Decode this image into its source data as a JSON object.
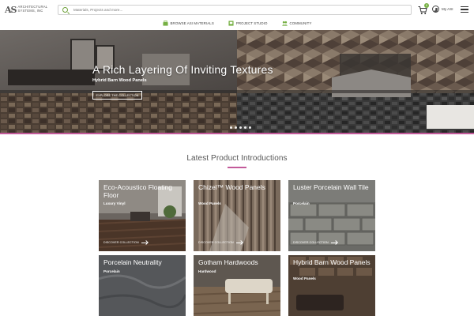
{
  "brand": {
    "mark": "AS",
    "name_line1": "ARCHITECTURAL",
    "name_line2": "SYSTEMS, INC"
  },
  "search": {
    "placeholder": "Materials, Projects and more..."
  },
  "cart": {
    "count": "0"
  },
  "account": {
    "label": "My ASI"
  },
  "nav": [
    {
      "label": "BROWSE ASI MATERIALS",
      "icon": "materials-icon"
    },
    {
      "label": "PROJECT STUDIO",
      "icon": "studio-icon"
    },
    {
      "label": "COMMUNITY",
      "icon": "community-icon"
    }
  ],
  "hero": {
    "title": "A Rich Layering Of Inviting Textures",
    "subtitle": "Hybrid Barn Wood Panels",
    "cta": "EXPLORE THE COLLECTION",
    "accent_color": "#c35a9a"
  },
  "section": {
    "title": "Latest Product Introductions"
  },
  "products": [
    {
      "title": "Eco-Acoustico Floating Floor",
      "category": "Luxury Vinyl",
      "cta": "DISCOVER COLLECTION"
    },
    {
      "title": "Chizel™ Wood Panels",
      "category": "Wood Panels",
      "cta": "DISCOVER COLLECTION"
    },
    {
      "title": "Luster Porcelain Wall Tile",
      "category": "Porcelain",
      "cta": "DISCOVER COLLECTION"
    },
    {
      "title": "Porcelain Neutrality",
      "category": "Porcelain",
      "cta": ""
    },
    {
      "title": "Gotham Hardwoods",
      "category": "Hardwood",
      "cta": ""
    },
    {
      "title": "Hybrid Barn Wood Panels",
      "category": "Wood Panels",
      "cta": ""
    }
  ],
  "colors": {
    "accent": "#c35a9a",
    "green": "#76b043"
  }
}
